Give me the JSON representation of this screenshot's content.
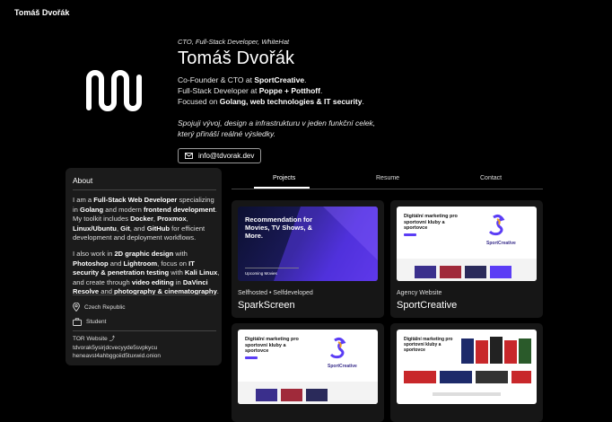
{
  "brand": "Tomáš Dvořák",
  "hero": {
    "role": "CTO, Full-Stack Developer, WhiteHat",
    "name": "Tomáš Dvořák",
    "line1_pre": "Co-Founder & CTO at ",
    "line1_bold": "SportCreative",
    "line1_post": ".",
    "line2_pre": "Full-Stack Developer at ",
    "line2_bold": "Poppe + Potthoff",
    "line2_post": ".",
    "line3_pre": "Focused on ",
    "line3_bold": "Golang, web technologies & IT security",
    "line3_post": ".",
    "tagline": "Spojuji vývoj, design a infrastrukturu v jeden funkční celek, který přináší reálné výsledky.",
    "email": "info@tdvorak.dev"
  },
  "about": {
    "title": "About",
    "p1": [
      {
        "t": "I am a ",
        "b": false
      },
      {
        "t": "Full-Stack Web Developer",
        "b": true
      },
      {
        "t": " specializing in ",
        "b": false
      },
      {
        "t": "Golang",
        "b": true
      },
      {
        "t": " and modern ",
        "b": false
      },
      {
        "t": "frontend development",
        "b": true
      },
      {
        "t": ". My toolkit includes ",
        "b": false
      },
      {
        "t": "Docker",
        "b": true
      },
      {
        "t": ", ",
        "b": false
      },
      {
        "t": "Proxmox",
        "b": true
      },
      {
        "t": ", ",
        "b": false
      },
      {
        "t": "Linux/Ubuntu",
        "b": true
      },
      {
        "t": ", ",
        "b": false
      },
      {
        "t": "Git",
        "b": true
      },
      {
        "t": ", and ",
        "b": false
      },
      {
        "t": "GitHub",
        "b": true
      },
      {
        "t": " for efficient development and deployment workflows.",
        "b": false
      }
    ],
    "p2": [
      {
        "t": "I also work in ",
        "b": false
      },
      {
        "t": "2D graphic design",
        "b": true
      },
      {
        "t": " with ",
        "b": false
      },
      {
        "t": "Photoshop",
        "b": true
      },
      {
        "t": " and ",
        "b": false
      },
      {
        "t": "Lightroom",
        "b": true
      },
      {
        "t": ", focus on ",
        "b": false
      },
      {
        "t": "IT security & penetration testing",
        "b": true
      },
      {
        "t": " with ",
        "b": false
      },
      {
        "t": "Kali Linux",
        "b": true
      },
      {
        "t": ", and create through ",
        "b": false
      },
      {
        "t": "video editing",
        "b": true
      },
      {
        "t": " in ",
        "b": false
      },
      {
        "t": "DaVinci Resolve",
        "b": true
      },
      {
        "t": " and ",
        "b": false
      },
      {
        "t": "photography & cinematography",
        "b": true
      },
      {
        "t": ".",
        "b": false
      }
    ],
    "location": "Czech Republic",
    "status": "Student",
    "tor_label": "TOR Website ⤴",
    "tor_line1": "tdvorak5ysirjdcvecyyde5svpkycu",
    "tor_line2": "heneavst4ahbggoiid5tuxwid.onion"
  },
  "tabs": [
    "Projects",
    "Resume",
    "Contact"
  ],
  "cards": [
    {
      "subtitle": "Selfhosted • Selfdeveloped",
      "title": "SparkScreen",
      "thumb_heading": "Recommendation for Movies, TV Shows, & More.",
      "thumb_label": "Upcoming Movies"
    },
    {
      "subtitle": "Agency Website",
      "title": "SportCreative",
      "thumb_heading": "Digitální marketing pro sportovní kluby a sportovce",
      "thumb_label": "SportCreative"
    },
    {
      "subtitle": "",
      "title": "",
      "thumb_heading": "Digitální marketing pro sportovní kluby a sportovce",
      "thumb_label": "SportCreative"
    },
    {
      "subtitle": "",
      "title": "",
      "thumb_heading": "Digitální marketing pro sportovní kluby a sportovce",
      "thumb_label": ""
    }
  ],
  "colors": {
    "background": "#000000",
    "card": "#161616",
    "panel": "#1b1b1b",
    "accent_purple": "#5b3df5"
  }
}
